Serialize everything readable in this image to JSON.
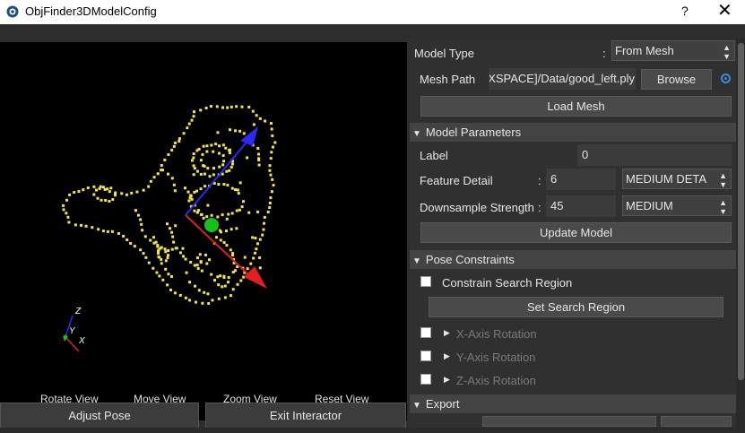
{
  "window": {
    "title": "ObjFinder3DModelConfig",
    "help_label": "?",
    "close_label": "✕"
  },
  "viewport": {
    "axis_labels": {
      "z": "Z",
      "y": "Y",
      "x": "X"
    },
    "buttons": {
      "rotate": "Rotate View",
      "move": "Move View",
      "zoom": "Zoom View",
      "reset": "Reset View"
    },
    "colors": {
      "points": "#f2e44a",
      "x_axis": "#e02020",
      "y_axis": "#18c018",
      "z_axis": "#2a2aff",
      "background": "#000000"
    }
  },
  "bottom_buttons": {
    "adjust_pose": "Adjust Pose",
    "exit_interactor": "Exit Interactor"
  },
  "panel": {
    "model_type": {
      "label": "Model Type",
      "colon": ":",
      "value": "From Mesh"
    },
    "mesh_path": {
      "label": "Mesh Path",
      "value": "XSPACE]/Data/good_left.ply",
      "browse": "Browse"
    },
    "load_mesh": "Load Mesh",
    "model_parameters": {
      "header": "Model Parameters",
      "label": {
        "label": "Label",
        "value": "0"
      },
      "feature_detail": {
        "label": "Feature Detail",
        "colon": ":",
        "value": "6",
        "level": "MEDIUM DETA"
      },
      "downsample_strength": {
        "label": "Downsample Strength",
        "colon": ":",
        "value": "45",
        "level": "MEDIUM"
      },
      "update_model": "Update Model"
    },
    "pose_constraints": {
      "header": "Pose Constraints",
      "constrain_search_region": "Constrain Search Region",
      "set_search_region": "Set Search Region",
      "x_rotation": "X-Axis Rotation",
      "y_rotation": "Y-Axis Rotation",
      "z_rotation": "Z-Axis Rotation"
    },
    "export": {
      "header": "Export"
    }
  },
  "colors": {
    "accent": "#3a8fd8"
  }
}
